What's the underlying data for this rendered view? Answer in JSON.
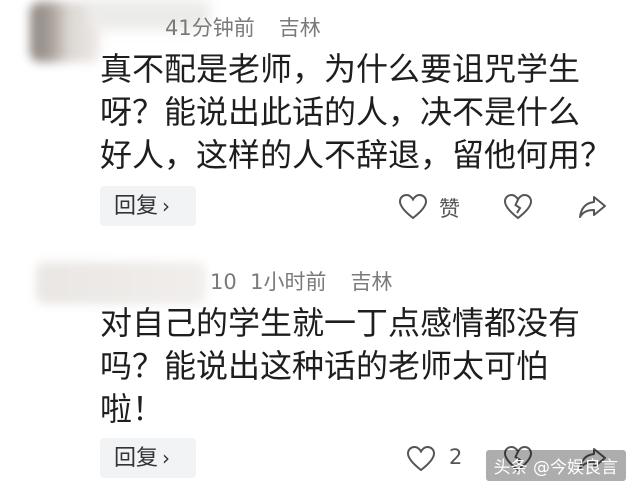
{
  "comments": [
    {
      "time": "41分钟前",
      "location": "吉林",
      "text": "真不配是老师，为什么要诅咒学生\n呀？能说出此话的人，决不是什么\n好人，这样的人不辞退，留他何用？",
      "reply_label": "回复",
      "like_label": "赞",
      "icons": [
        "heart-outline-icon",
        "broken-heart-icon",
        "share-arrow-icon"
      ]
    },
    {
      "time_prefix": "10",
      "time": "1小时前",
      "location": "吉林",
      "text": "对自己的学生就一丁点感情都没有\n吗？能说出这种话的老师太可怕\n啦！",
      "reply_label": "回复",
      "like_count": "2",
      "icons": [
        "heart-outline-icon",
        "broken-heart-icon",
        "share-arrow-icon"
      ]
    }
  ],
  "watermark": "头条 @今娱良言",
  "colors": {
    "meta": "#7a7a7a",
    "reply_bg": "#f2f3f5",
    "text": "#1e1e1e"
  }
}
